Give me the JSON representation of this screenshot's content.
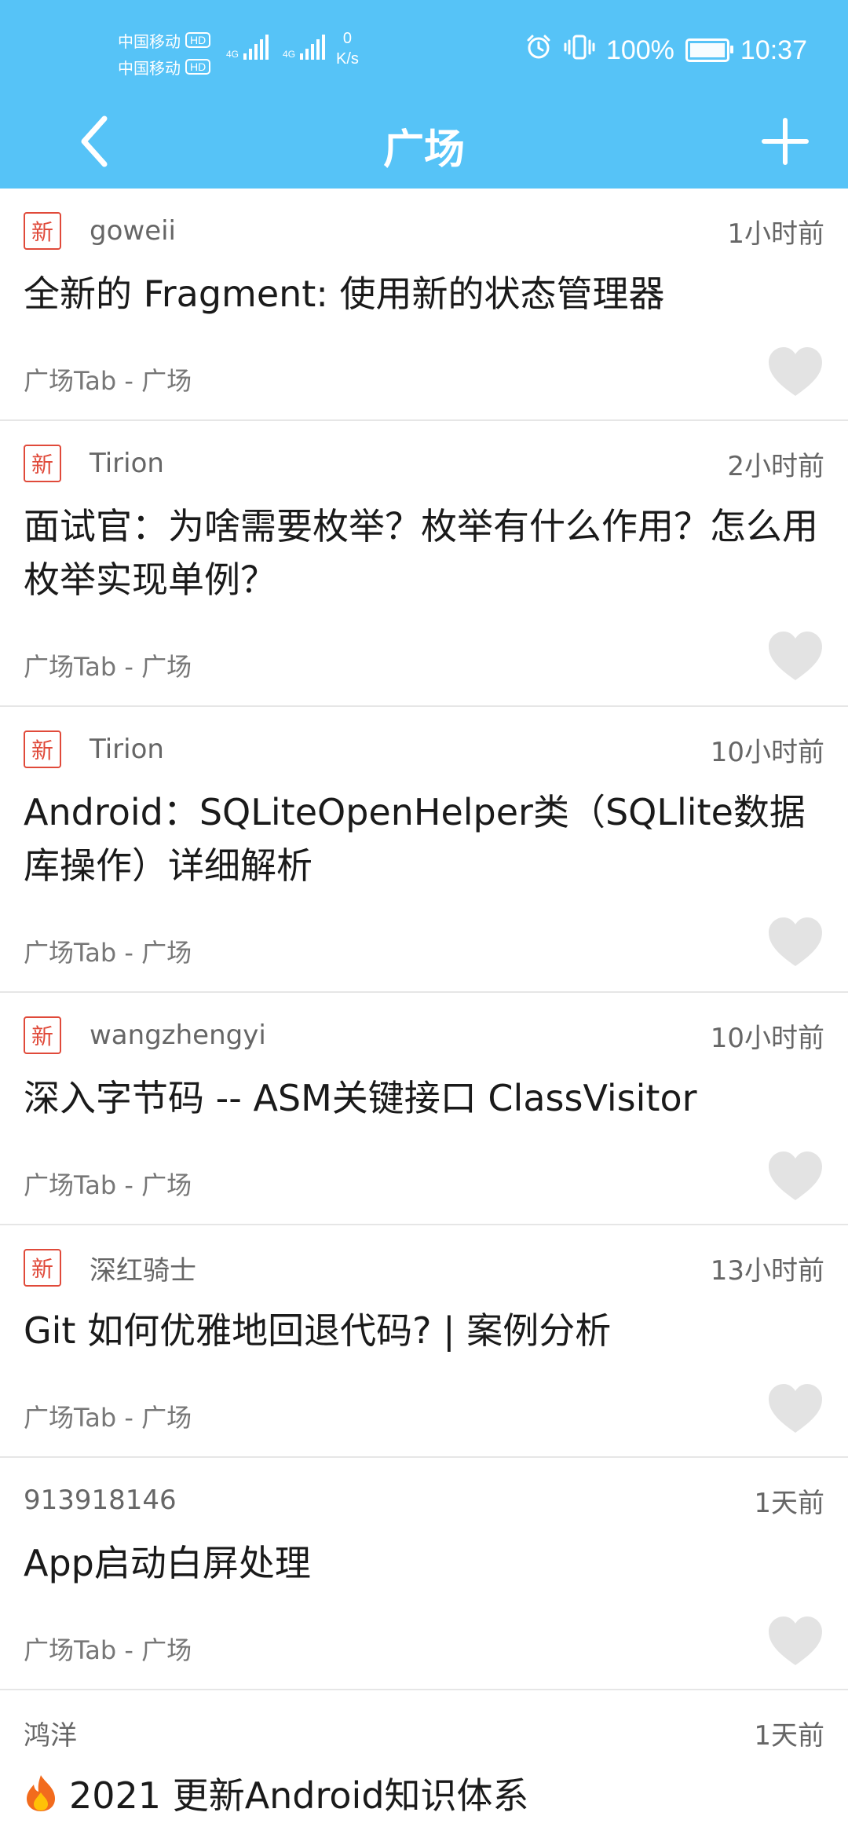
{
  "status_bar": {
    "carrier1": "中国移动",
    "carrier2": "中国移动",
    "hd1": "HD",
    "hd2": "HD",
    "net1": "4G",
    "net2": "4G",
    "speed_value": "0",
    "speed_unit": "K/s",
    "battery": "100%",
    "time": "10:37"
  },
  "header": {
    "title": "广场"
  },
  "items": [
    {
      "new_badge": "新",
      "author": "goweii",
      "time": "1小时前",
      "title": "全新的 Fragment: 使用新的状态管理器",
      "tag": "广场Tab - 广场"
    },
    {
      "new_badge": "新",
      "author": "Tirion",
      "time": "2小时前",
      "title": "面试官：为啥需要枚举？枚举有什么作用？怎么用枚举实现单例？",
      "tag": "广场Tab - 广场"
    },
    {
      "new_badge": "新",
      "author": "Tirion",
      "time": "10小时前",
      "title": "Android：SQLiteOpenHelper类（SQLlite数据库操作）详细解析",
      "tag": "广场Tab - 广场"
    },
    {
      "new_badge": "新",
      "author": "wangzhengyi",
      "time": "10小时前",
      "title": "深入字节码 -- ASM关键接口 ClassVisitor",
      "tag": "广场Tab - 广场"
    },
    {
      "new_badge": "新",
      "author": "深红骑士",
      "time": "13小时前",
      "title": "Git 如何优雅地回退代码? | 案例分析",
      "tag": "广场Tab - 广场"
    },
    {
      "author": "913918146",
      "time": "1天前",
      "title": "App启动白屏处理",
      "tag": "广场Tab - 广场"
    },
    {
      "author": "鸿洋",
      "time": "1天前",
      "title": "2021 更新Android知识体系"
    }
  ],
  "colors": {
    "header": "#56C3F7",
    "badge": "#E04A3A",
    "heart": "#e3e3e3"
  }
}
